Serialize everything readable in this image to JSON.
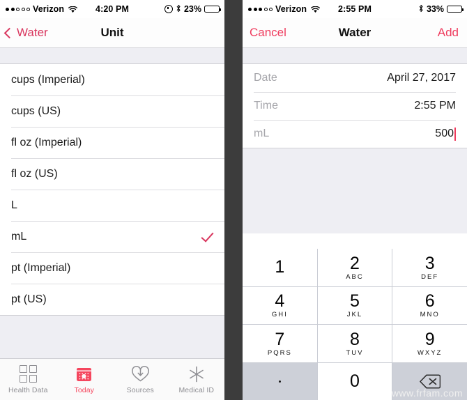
{
  "left": {
    "status": {
      "signal_dots_filled": 2,
      "signal_dots_total": 5,
      "carrier": "Verizon",
      "wifi_icon": "wifi-icon",
      "time": "4:20 PM",
      "alarm_icon": "alarm-clock-icon",
      "bluetooth_icon": "bluetooth-icon",
      "battery_percent": "23%",
      "battery_level": 23
    },
    "nav": {
      "back_label": "Water",
      "back_icon": "chevron-left-icon",
      "title": "Unit"
    },
    "units": [
      {
        "label": "cups (Imperial)",
        "selected": false
      },
      {
        "label": "cups (US)",
        "selected": false
      },
      {
        "label": "fl oz (Imperial)",
        "selected": false
      },
      {
        "label": "fl oz (US)",
        "selected": false
      },
      {
        "label": "L",
        "selected": false
      },
      {
        "label": "mL",
        "selected": true
      },
      {
        "label": "pt (Imperial)",
        "selected": false
      },
      {
        "label": "pt (US)",
        "selected": false
      }
    ],
    "checkmark_icon": "checkmark-icon",
    "tabs": [
      {
        "label": "Health Data",
        "icon": "grid-squares-icon",
        "active": false
      },
      {
        "label": "Today",
        "icon": "calendar-icon",
        "active": true
      },
      {
        "label": "Sources",
        "icon": "heart-download-icon",
        "active": false
      },
      {
        "label": "Medical ID",
        "icon": "medical-asterisk-icon",
        "active": false
      }
    ]
  },
  "right": {
    "status": {
      "signal_dots_filled": 3,
      "signal_dots_total": 5,
      "carrier": "Verizon",
      "wifi_icon": "wifi-icon",
      "time": "2:55 PM",
      "bluetooth_icon": "bluetooth-icon",
      "battery_percent": "33%",
      "battery_level": 33
    },
    "nav": {
      "cancel_label": "Cancel",
      "title": "Water",
      "add_label": "Add"
    },
    "form": [
      {
        "label": "Date",
        "value": "April 27, 2017",
        "editing": false
      },
      {
        "label": "Time",
        "value": "2:55 PM",
        "editing": false
      },
      {
        "label": "mL",
        "value": "500",
        "editing": true
      }
    ],
    "keypad": [
      {
        "num": "1",
        "sub": "",
        "style": "white"
      },
      {
        "num": "2",
        "sub": "ABC",
        "style": "white"
      },
      {
        "num": "3",
        "sub": "DEF",
        "style": "white"
      },
      {
        "num": "4",
        "sub": "GHI",
        "style": "white"
      },
      {
        "num": "5",
        "sub": "JKL",
        "style": "white"
      },
      {
        "num": "6",
        "sub": "MNO",
        "style": "white"
      },
      {
        "num": "7",
        "sub": "PQRS",
        "style": "white"
      },
      {
        "num": "8",
        "sub": "TUV",
        "style": "white"
      },
      {
        "num": "9",
        "sub": "WXYZ",
        "style": "white"
      },
      {
        "num": ".",
        "sub": "",
        "style": "dim",
        "icon": "period-icon"
      },
      {
        "num": "0",
        "sub": "",
        "style": "white"
      },
      {
        "num": "",
        "sub": "",
        "style": "dim",
        "icon": "backspace-delete-icon"
      }
    ],
    "watermark": "www.frfam.com"
  },
  "colors": {
    "accent_pink": "#ef3c5e",
    "accent_dark_pink": "#d9365e",
    "table_bg": "#eeeef3",
    "keypad_dim": "#cdd0d8",
    "gutter": "#3c3c3c"
  }
}
